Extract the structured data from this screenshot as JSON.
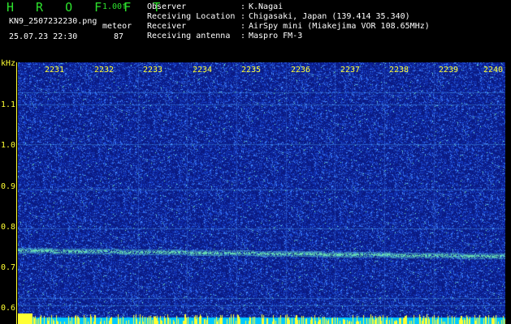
{
  "app": {
    "title": "H R O F F T",
    "version": "1.00f",
    "filename": "KN9_2507232230.png",
    "datetime": "25.07.23 22:30",
    "meteor_label": "meteor",
    "meteor_count": "87"
  },
  "info": [
    {
      "label": "Observer",
      "value": "K.Nagai"
    },
    {
      "label": "Receiving Location",
      "value": "Chigasaki, Japan (139.414 35.340)"
    },
    {
      "label": "Receiver",
      "value": "AirSpy mini (Miakejima VOR 108.65MHz)"
    },
    {
      "label": "Receiving antenna",
      "value": "Maspro FM-3"
    }
  ],
  "separator": ":",
  "axis": {
    "unit": "kHz",
    "time_ticks": [
      "2231",
      "2232",
      "2233",
      "2234",
      "2235",
      "2236",
      "2237",
      "2238",
      "2239",
      "2240"
    ],
    "freq_ticks": [
      "1.1",
      "1.0",
      "0.9",
      "0.8",
      "0.7",
      "0.6"
    ]
  },
  "colors": {
    "background": "#000000",
    "title_green": "#2de12d",
    "label_yellow": "#ffff33",
    "text_white": "#ffffff",
    "spectrogram_base": "#0a1a82",
    "spectrogram_noise": "#3c78ff",
    "signal_band": "#64e6b4",
    "bottom_strip_cyan": "#00c8ff",
    "bottom_strip_yellow": "#ffff33"
  }
}
